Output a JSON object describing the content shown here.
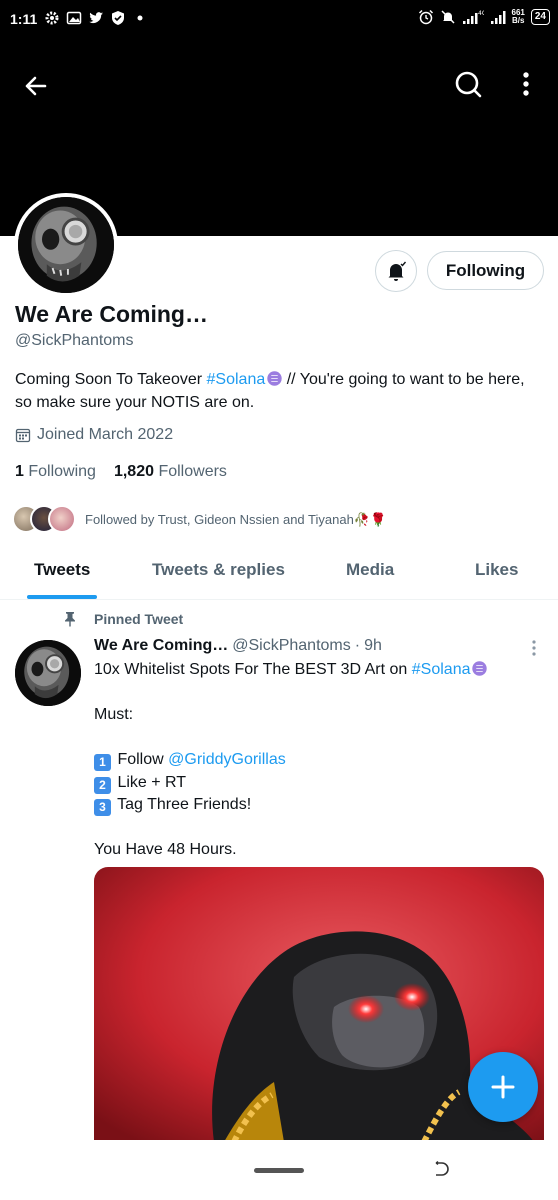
{
  "statusbar": {
    "time": "1:11",
    "network_label": "4G",
    "net_speed_value": "661",
    "net_speed_unit": "B/s",
    "battery": "24"
  },
  "profile": {
    "display_name": "We Are Coming…",
    "handle": "@SickPhantoms",
    "bio_prefix": "Coming Soon To Takeover ",
    "bio_hashtag": "#Solana",
    "bio_suffix": "  // You're going to want to be here, so make sure your NOTIS are on.",
    "joined": "Joined March 2022",
    "following_count": "1",
    "following_label": "Following",
    "followers_count": "1,820",
    "followers_label": "Followers",
    "followed_by": "Followed by Trust, Gideon Nssien and Tiyanah🥀🌹",
    "follow_button": "Following"
  },
  "tabs": [
    "Tweets",
    "Tweets & replies",
    "Media",
    "Likes"
  ],
  "pinned_tweet": {
    "pinned_label": "Pinned Tweet",
    "author_name": "We Are Coming…",
    "author_handle": "@SickPhantoms",
    "separator": "·",
    "time": "9h",
    "line1_prefix": "10x Whitelist Spots For The BEST 3D Art on ",
    "line1_hashtag": "#Solana",
    "must": "Must:",
    "step1_key": "1",
    "step1_prefix": "Follow ",
    "step1_mention": "@GriddyGorillas",
    "step2_key": "2",
    "step2_text": "Like + RT",
    "step3_key": "3",
    "step3_text": "Tag Three Friends!",
    "closing": "You Have 48 Hours."
  },
  "colors": {
    "accent": "#1d9bf0",
    "muted_text": "#536471",
    "banner": "#000000"
  },
  "icons": [
    "back-arrow-icon",
    "search-icon",
    "more-vertical-icon",
    "bell-icon",
    "calendar-icon",
    "pin-icon",
    "solana-icon",
    "compose-plus-icon"
  ]
}
